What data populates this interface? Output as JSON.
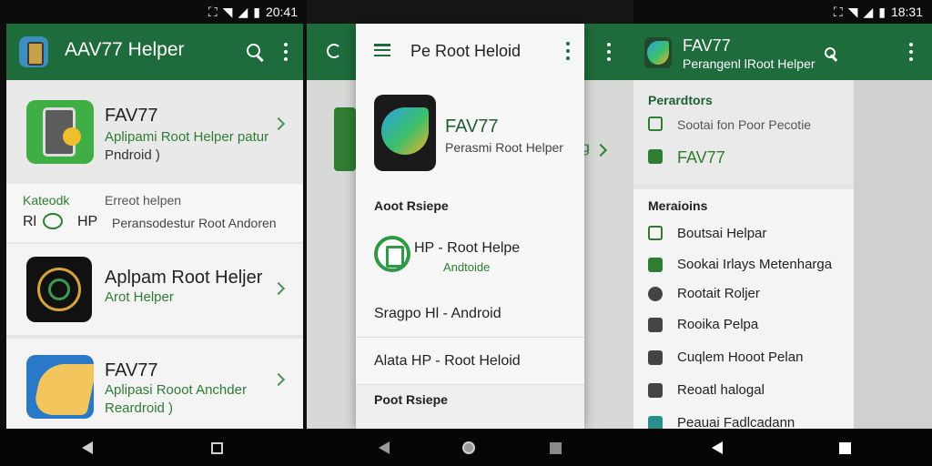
{
  "status": {
    "left_time": "20:41",
    "right_time": "18:31"
  },
  "panel1": {
    "title": "AAV77 Helper",
    "cards": [
      {
        "title": "FAV77",
        "line1": "Aplipami Root Helper patur",
        "line2": "Pndroid )"
      },
      {
        "title": "Aplpam Root Heljer",
        "line1": "Arot Helper"
      },
      {
        "title": "FAV77",
        "line1": "Aplipasi Rooot Anchder",
        "line2": "Reardroid )"
      }
    ],
    "row2": {
      "label_green": "Kateodk",
      "label_right": "Erreot helpen",
      "badge_text": "Rl",
      "hp": "HP",
      "desc": "Peransodestur Root Andoren"
    }
  },
  "panel2": {
    "drawer_title": "Pe Root Heloid",
    "app_name": "FAV77",
    "app_sub": "Perasmi Root Helper",
    "section1": "Aoot Rsiepe",
    "hp_title": "HP - Root Helpe",
    "hp_sub": "Andtoide",
    "item1": "Sragpo Hl - Android",
    "item2": "Alata HP - Root Heloid",
    "section2": "Poot Rsiepe",
    "side_partial": "g"
  },
  "panel3": {
    "title": "FAV77",
    "subtitle": "Perangenl lRoot Helper",
    "card1_header": "Perardtors",
    "card1_row1": "Sootai fon Poor Pecotie",
    "card1_row2": "FAV77",
    "card2_header": "Meraioins",
    "items": [
      "Boutsai Helpar",
      "Sookai Irlays Metenharga",
      "Rootait Roljer",
      "Rooika Pelpa",
      "Cuqlem Hooot Pelan",
      "Reoatl halogal",
      "Peauai Fadlcadann"
    ]
  },
  "colors": {
    "primary": "#1e6b3c",
    "accent_green": "#2e7d32",
    "background": "#e6e6e6",
    "navbar": "#050505"
  }
}
